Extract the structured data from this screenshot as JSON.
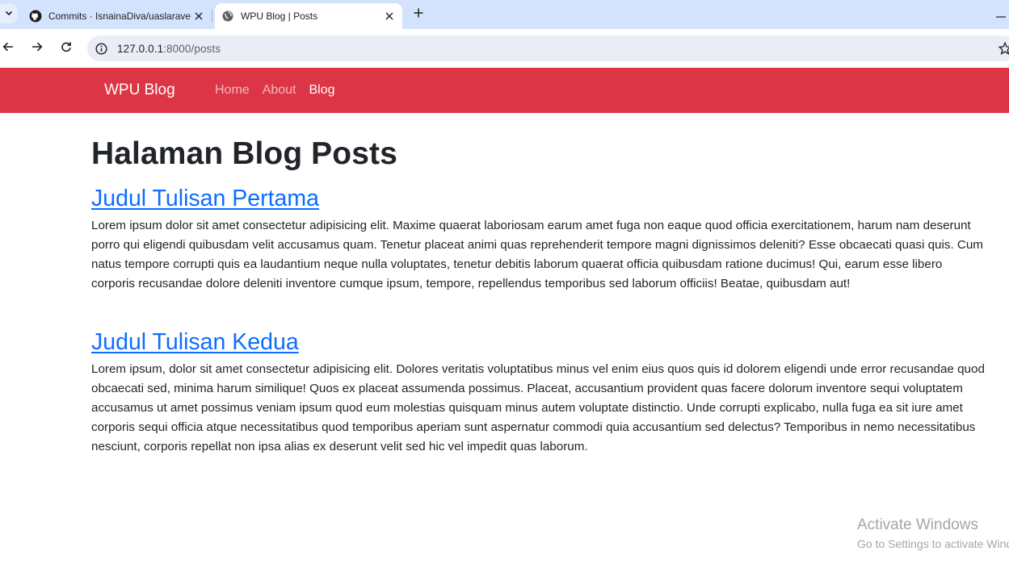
{
  "browser": {
    "tabs": [
      {
        "title": "Commits · IsnainaDiva/uaslaravel",
        "icon": "github-icon",
        "active": false
      },
      {
        "title": "WPU Blog | Posts",
        "icon": "globe-icon",
        "active": true
      }
    ],
    "url": {
      "host": "127.0.0.1",
      "rest": ":8000/posts"
    }
  },
  "navbar": {
    "brand": "WPU Blog",
    "links": [
      {
        "label": "Home",
        "active": false
      },
      {
        "label": "About",
        "active": false
      },
      {
        "label": "Blog",
        "active": true
      }
    ],
    "color": "#dc3545"
  },
  "main": {
    "heading": "Halaman Blog Posts",
    "posts": [
      {
        "title": "Judul Tulisan Pertama",
        "body": "Lorem ipsum dolor sit amet consectetur adipisicing elit. Maxime quaerat laboriosam earum amet fuga non eaque quod officia exercitationem, harum nam deserunt porro qui eligendi quibusdam velit accusamus quam. Tenetur placeat animi quas reprehenderit tempore magni dignissimos deleniti? Esse obcaecati quasi quis. Cum natus tempore corrupti quis ea laudantium neque nulla voluptates, tenetur debitis laborum quaerat officia quibusdam ratione ducimus! Qui, earum esse libero corporis recusandae dolore deleniti inventore cumque ipsum, tempore, repellendus temporibus sed laborum officiis! Beatae, quibusdam aut!"
      },
      {
        "title": "Judul Tulisan Kedua",
        "body": "Lorem ipsum, dolor sit amet consectetur adipisicing elit. Dolores veritatis voluptatibus minus vel enim eius quos quis id dolorem eligendi unde error recusandae quod obcaecati sed, minima harum similique! Quos ex placeat assumenda possimus. Placeat, accusantium provident quas facere dolorum inventore sequi voluptatem accusamus ut amet possimus veniam ipsum quod eum molestias quisquam minus autem voluptate distinctio. Unde corrupti explicabo, nulla fuga ea sit iure amet corporis sequi officia atque necessitatibus quod temporibus aperiam sunt aspernatur commodi quia accusantium sed delectus? Temporibus in nemo necessitatibus nesciunt, corporis repellat non ipsa alias ex deserunt velit sed hic vel impedit quas laborum."
      }
    ],
    "link_color": "#0d6efd"
  },
  "watermark": {
    "title": "Activate Windows",
    "subtitle": "Go to Settings to activate Windows."
  }
}
